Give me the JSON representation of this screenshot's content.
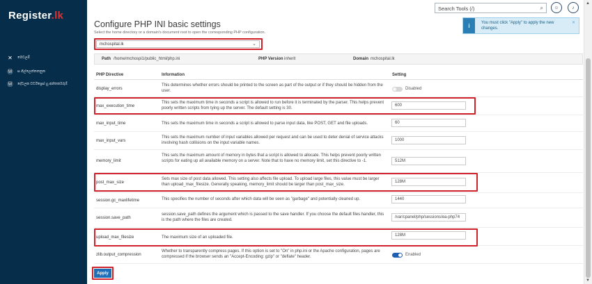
{
  "brand": {
    "name": "Register",
    "suffix": ".lk"
  },
  "sidebar": {
    "items": [
      {
        "icon": "tools-icon",
        "label": "මෙවලම්"
      },
      {
        "icon": "wordpress-icon",
        "label": "ස ගිල්ලෙන්නනනුක"
      },
      {
        "icon": "wordpress-icon",
        "label": "දේවලක වර්ඩ්ප්‍රෙස් හු අන්තර්කරුම්"
      }
    ]
  },
  "header": {
    "search_placeholder": "Search Tools (/)"
  },
  "notice": {
    "text": "You must click \"Apply\" to apply the new changes."
  },
  "page": {
    "title": "Configure PHP INI basic settings",
    "subtitle": "Select the home directory or a domain's document root to open the corresponding PHP configuration.",
    "selected_domain": "mchospital.lk"
  },
  "info_bar": {
    "path_label": "Path",
    "path_value": "/home/mchospi1/public_html/php.ini",
    "php_label": "PHP Version",
    "php_value": "inherit",
    "domain_label": "Domain",
    "domain_value": "mchospital.lk"
  },
  "table": {
    "headers": {
      "directive": "PHP Directive",
      "information": "Information",
      "setting": "Setting"
    },
    "rows": [
      {
        "directive": "display_errors",
        "info": "This determines whether errors should be printed to the screen as part of the output or if they should be hidden from the user.",
        "setting": "Disabled",
        "type": "toggle",
        "on": false
      },
      {
        "directive": "max_execution_time",
        "info": "This sets the maximum time in seconds a script is allowed to run before it is terminated by the parser. This helps prevent poorly written scripts from tying up the server. The default setting is 30.",
        "setting": "600",
        "type": "input"
      },
      {
        "directive": "max_input_time",
        "info": "This sets the maximum time in seconds a script is allowed to parse input data, like POST, GET and file uploads.",
        "setting": "60",
        "type": "input"
      },
      {
        "directive": "max_input_vars",
        "info": "This sets the maximum number of input variables allowed per request and can be used to deter denial of service attacks involving hash collisions on the input variable names.",
        "setting": "1000",
        "type": "input"
      },
      {
        "directive": "memory_limit",
        "info": "This sets the maximum amount of memory in bytes that a script is allowed to allocate. This helps prevent poorly written scripts for eating up all available memory on a server. Note that to have no memory limit, set this directive to -1.",
        "setting": "512M",
        "type": "input"
      },
      {
        "directive": "post_max_size",
        "info": "Sets max size of post data allowed. This setting also affects file upload. To upload large files, this value must be larger than upload_max_filesize. Generally speaking, memory_limit should be larger than post_max_size.",
        "setting": "128M",
        "type": "input"
      },
      {
        "directive": "session.gc_maxlifetime",
        "info": "This specifies the number of seconds after which data will be seen as \"garbage\" and potentially cleaned up.",
        "setting": "1440",
        "type": "input"
      },
      {
        "directive": "session.save_path",
        "info": "session.save_path defines the argument which is passed to the save handler. If you choose the default files handler, this is the path where the files are created.",
        "setting": "/var/cpanel/php/sessions/ea-php74",
        "type": "input"
      },
      {
        "directive": "upload_max_filesize",
        "info": "The maximum size of an uploaded file.",
        "setting": "128M",
        "type": "input"
      },
      {
        "directive": "zlib.output_compression",
        "info": "Whether to transparently compress pages. If this option is set to \"On\" in php.ini or the Apache configuration, pages are compressed if the browser sends an \"Accept-Encoding: gzip\" or \"deflate\" header.",
        "setting": "Enabled",
        "type": "toggle",
        "on": true
      }
    ]
  },
  "apply_label": "Apply",
  "colors": {
    "sidebar": "#062d4a",
    "highlight": "#d0202a",
    "primary": "#1f6fb8"
  }
}
